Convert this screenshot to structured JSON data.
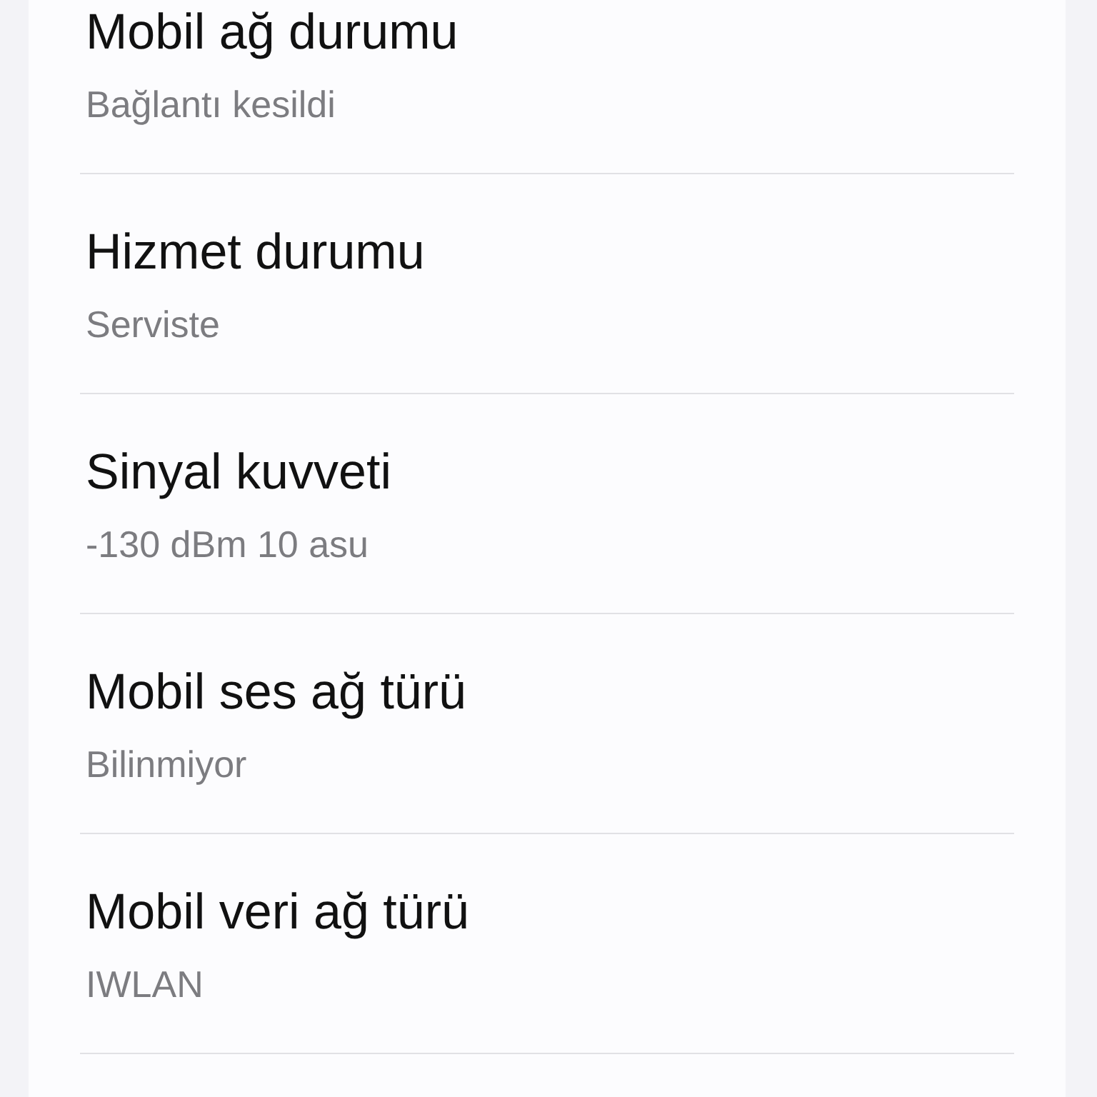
{
  "items": [
    {
      "title": "Mobil ağ durumu",
      "value": "Bağlantı kesildi"
    },
    {
      "title": "Hizmet durumu",
      "value": "Serviste"
    },
    {
      "title": "Sinyal kuvveti",
      "value": "-130 dBm 10 asu"
    },
    {
      "title": "Mobil ses ağ türü",
      "value": "Bilinmiyor"
    },
    {
      "title": "Mobil veri ağ türü",
      "value": "IWLAN"
    }
  ]
}
